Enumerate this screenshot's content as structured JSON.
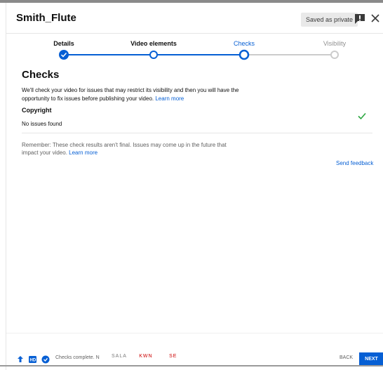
{
  "header": {
    "title": "Smith_Flute",
    "saved_badge": "Saved as private",
    "feedback_icon": "feedback-icon",
    "close_icon": "close-icon"
  },
  "stepper": {
    "steps": [
      {
        "label": "Details",
        "state": "done"
      },
      {
        "label": "Video elements",
        "state": "done"
      },
      {
        "label": "Checks",
        "state": "active"
      },
      {
        "label": "Visibility",
        "state": "todo"
      }
    ],
    "colors": {
      "active": "#065fd4",
      "inactive": "#cccccc"
    }
  },
  "checks": {
    "title": "Checks",
    "description": "We'll check your video for issues that may restrict its visibility and then you will have the opportunity to fix issues before publishing your video.",
    "learn_more": "Learn more",
    "copyright": {
      "title": "Copyright",
      "status": "No issues found",
      "status_icon": "check-icon",
      "status_color": "#2ba640"
    },
    "remember": "Remember: These check results aren't final. Issues may come up in the future that impact your video.",
    "remember_learn_more": "Learn more",
    "send_feedback": "Send feedback"
  },
  "footer": {
    "status_text": "Checks complete. N",
    "noise_text_1": "SALA",
    "noise_text_2": "KWN",
    "noise_text_3": "SE",
    "back_label": "BACK",
    "next_label": "NEXT",
    "accent_color": "#065fd4"
  }
}
